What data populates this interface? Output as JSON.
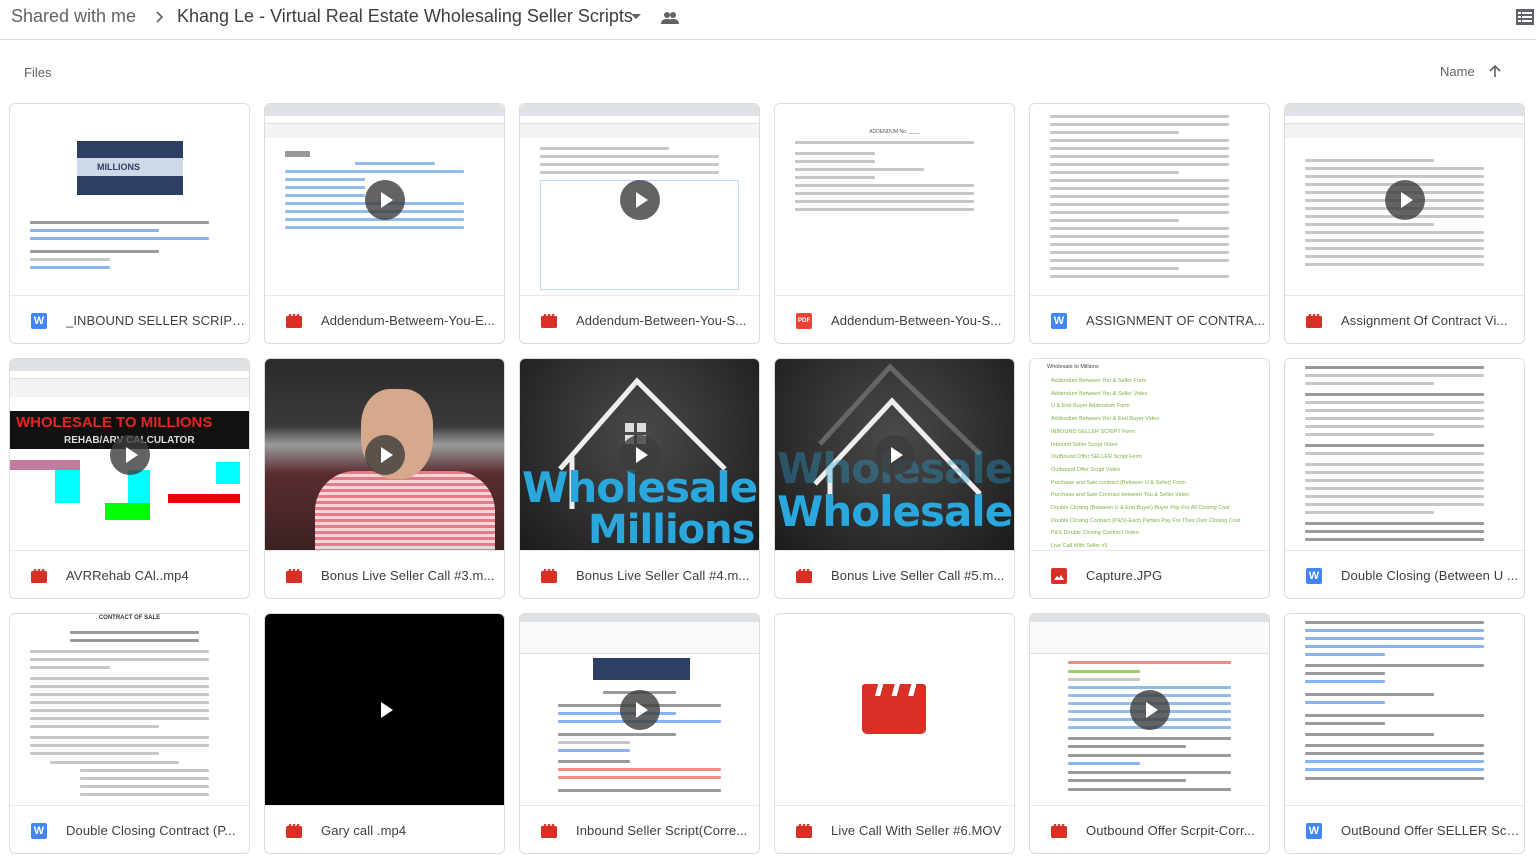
{
  "header": {
    "breadcrumb_root": "Shared with me",
    "breadcrumb_current": "Khang Le - Virtual Real Estate Wholesaling Seller Scripts",
    "icons": {
      "separator": "chevron-right-icon",
      "dropdown": "caret-down-icon",
      "shared": "people-icon",
      "view_toggle": "list-view-icon"
    }
  },
  "section": {
    "files_label": "Files",
    "sort_label": "Name",
    "sort_direction": "ascending"
  },
  "colors": {
    "doc_blue": "#4285f4",
    "video_red": "#d93025",
    "pdf_red": "#ea4335",
    "image_red": "#d93025",
    "calc_title_red": "#e52323",
    "wholesale_blue": "#2aa7dc"
  },
  "files": [
    {
      "name": "_INBOUND SELLER SCRIPT ...",
      "type": "word",
      "type_icon": "W",
      "thumb": "doc-banner",
      "banner_text": "MILLIONS",
      "video": false
    },
    {
      "name": "Addendum-Betweem-You-E...",
      "type": "video",
      "thumb": "screen-form",
      "video": true
    },
    {
      "name": "Addendum-Between-You-S...",
      "type": "video",
      "thumb": "screen-form2",
      "video": true
    },
    {
      "name": "Addendum-Between-You-S...",
      "type": "pdf",
      "type_icon": "PDF",
      "thumb": "doc-addendum",
      "doc_heading": "ADDENDUM No. ____",
      "video": false
    },
    {
      "name": "ASSIGNMENT OF CONTRA...",
      "type": "word",
      "type_icon": "W",
      "thumb": "doc-text",
      "video": false
    },
    {
      "name": "Assignment Of Contract Vi...",
      "type": "video",
      "thumb": "screen-doc",
      "video": true
    },
    {
      "name": "AVRRehab CAl..mp4",
      "type": "video",
      "thumb": "calculator",
      "calc_title": "WHOLESALE TO MILLIONS",
      "calc_subtitle": "REHAB/ARV CALCULATOR",
      "video": true
    },
    {
      "name": "Bonus Live Seller Call #3.m...",
      "type": "video",
      "thumb": "car-selfie",
      "video": true
    },
    {
      "name": "Bonus Live Seller Call #4.m...",
      "type": "video",
      "thumb": "logo",
      "logo_line1": "Wholesale",
      "logo_line2": "Millions",
      "video": true
    },
    {
      "name": "Bonus Live Seller Call #5.m...",
      "type": "video",
      "thumb": "logo-fade",
      "logo_line1": "Wholesale",
      "video": true
    },
    {
      "name": "Capture.JPG",
      "type": "image",
      "thumb": "link-list",
      "list_heading": "Wholesale to Millions",
      "list_items": [
        "Addendum Between You & Seller Form",
        "Addendum Between You & Seller Video",
        "U & End Buyer Addendum Form",
        "Addendum Between You & End Buyer Video",
        "INBOUND SELLER SCRIPT Form",
        "Inbound Seller Script Video",
        "OutBound Offer SELLER Script Form",
        "Outbound Offer Script Video",
        "Purchase and Sale contract (Between U & Seller) Form",
        "Purchase and Sale Contract between You & Seller Video",
        "Double Closing (Between U & End Buyer) Buyer Pay For All Closing Cost",
        "Double Closing Contract (P&S)-Each Parties Pay For Their Own Closing Cost",
        "P&S Double Closing Contract Video",
        "Live Call With Seller #1"
      ],
      "video": false
    },
    {
      "name": "Double Closing (Between U ...",
      "type": "word",
      "type_icon": "W",
      "thumb": "doc-text",
      "video": false
    },
    {
      "name": "Double Closing Contract (P...",
      "type": "word",
      "type_icon": "W",
      "thumb": "doc-contract",
      "doc_heading": "CONTRACT OF SALE",
      "video": false
    },
    {
      "name": "Gary call .mp4",
      "type": "video",
      "thumb": "black",
      "video": true
    },
    {
      "name": "Inbound Seller Script(Corre...",
      "type": "video",
      "thumb": "screen-doc2",
      "video": true
    },
    {
      "name": "Live Call With Seller #6.MOV",
      "type": "video",
      "thumb": "clapper",
      "video": false
    },
    {
      "name": "Outbound Offer Scrpit-Corr...",
      "type": "video",
      "thumb": "screen-doc3",
      "video": true
    },
    {
      "name": "OutBound Offer SELLER Scr...",
      "type": "word",
      "type_icon": "W",
      "thumb": "doc-text2",
      "video": false
    }
  ]
}
